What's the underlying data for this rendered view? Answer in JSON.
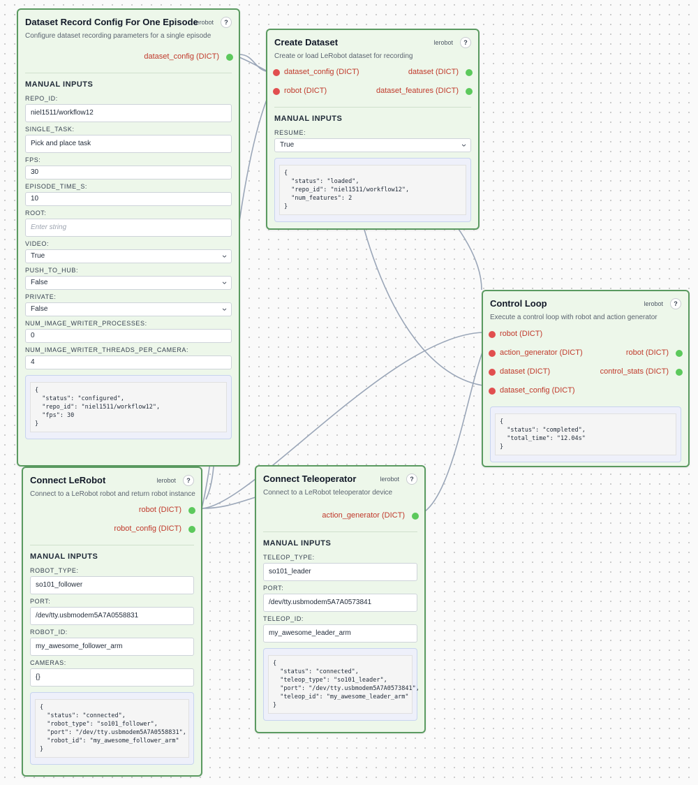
{
  "nodes": {
    "dataset_record_config": {
      "title": "Dataset Record Config For One Episode",
      "tag": "lerobot",
      "help": "?",
      "description": "Configure dataset recording parameters for a single episode",
      "outputs": [
        "dataset_config (DICT)"
      ],
      "manual_inputs_title": "MANUAL INPUTS",
      "fields": {
        "repo_id": {
          "label": "REPO_ID:",
          "value": "niel1511/workflow12"
        },
        "single_task": {
          "label": "SINGLE_TASK:",
          "value": "Pick and place task"
        },
        "fps": {
          "label": "FPS:",
          "value": "30"
        },
        "episode_time_s": {
          "label": "EPISODE_TIME_S:",
          "value": "10"
        },
        "root": {
          "label": "ROOT:",
          "placeholder": "Enter string"
        },
        "video": {
          "label": "VIDEO:",
          "value": "True"
        },
        "push_to_hub": {
          "label": "PUSH_TO_HUB:",
          "value": "False"
        },
        "private": {
          "label": "PRIVATE:",
          "value": "False"
        },
        "num_image_writer_processes": {
          "label": "NUM_IMAGE_WRITER_PROCESSES:",
          "value": "0"
        },
        "num_image_writer_threads": {
          "label": "NUM_IMAGE_WRITER_THREADS_PER_CAMERA:",
          "value": "4"
        }
      },
      "result": "{\n  \"status\": \"configured\",\n  \"repo_id\": \"niel1511/workflow12\",\n  \"fps\": 30\n}"
    },
    "create_dataset": {
      "title": "Create Dataset",
      "tag": "lerobot",
      "help": "?",
      "description": "Create or load LeRobot dataset for recording",
      "inputs": [
        "dataset_config (DICT)",
        "robot (DICT)"
      ],
      "outputs": [
        "dataset (DICT)",
        "dataset_features (DICT)"
      ],
      "manual_inputs_title": "MANUAL INPUTS",
      "fields": {
        "resume": {
          "label": "RESUME:",
          "value": "True"
        }
      },
      "result": "{\n  \"status\": \"loaded\",\n  \"repo_id\": \"niel1511/workflow12\",\n  \"num_features\": 2\n}"
    },
    "control_loop": {
      "title": "Control Loop",
      "tag": "lerobot",
      "help": "?",
      "description": "Execute a control loop with robot and action generator",
      "inputs": [
        "robot (DICT)",
        "action_generator (DICT)",
        "dataset (DICT)",
        "dataset_config (DICT)"
      ],
      "outputs": [
        "robot (DICT)",
        "control_stats (DICT)"
      ],
      "result": "{\n  \"status\": \"completed\",\n  \"total_time\": \"12.04s\"\n}"
    },
    "connect_lerobot": {
      "title": "Connect LeRobot",
      "tag": "lerobot",
      "help": "?",
      "description": "Connect to a LeRobot robot and return robot instance",
      "outputs": [
        "robot (DICT)",
        "robot_config (DICT)"
      ],
      "manual_inputs_title": "MANUAL INPUTS",
      "fields": {
        "robot_type": {
          "label": "ROBOT_TYPE:",
          "value": "so101_follower"
        },
        "port": {
          "label": "PORT:",
          "value": "/dev/tty.usbmodem5A7A0558831"
        },
        "robot_id": {
          "label": "ROBOT_ID:",
          "value": "my_awesome_follower_arm"
        },
        "cameras": {
          "label": "CAMERAS:",
          "value": "{}"
        }
      },
      "result": "{\n  \"status\": \"connected\",\n  \"robot_type\": \"so101_follower\",\n  \"port\": \"/dev/tty.usbmodem5A7A0558831\",\n  \"robot_id\": \"my_awesome_follower_arm\"\n}"
    },
    "connect_teleoperator": {
      "title": "Connect Teleoperator",
      "tag": "lerobot",
      "help": "?",
      "description": "Connect to a LeRobot teleoperator device",
      "outputs": [
        "action_generator (DICT)"
      ],
      "manual_inputs_title": "MANUAL INPUTS",
      "fields": {
        "teleop_type": {
          "label": "TELEOP_TYPE:",
          "value": "so101_leader"
        },
        "port": {
          "label": "PORT:",
          "value": "/dev/tty.usbmodem5A7A0573841"
        },
        "teleop_id": {
          "label": "TELEOP_ID:",
          "value": "my_awesome_leader_arm"
        }
      },
      "result": "{\n  \"status\": \"connected\",\n  \"teleop_type\": \"so101_leader\",\n  \"port\": \"/dev/tty.usbmodem5A7A0573841\",\n  \"teleop_id\": \"my_awesome_leader_arm\"\n}"
    }
  },
  "colors": {
    "node_bg": "#edf7ea",
    "node_border": "#5a9a60",
    "input_port": "#e14f4f",
    "output_port": "#5cc95c",
    "port_label": "#c0392b",
    "edge": "#9aa6b8"
  }
}
